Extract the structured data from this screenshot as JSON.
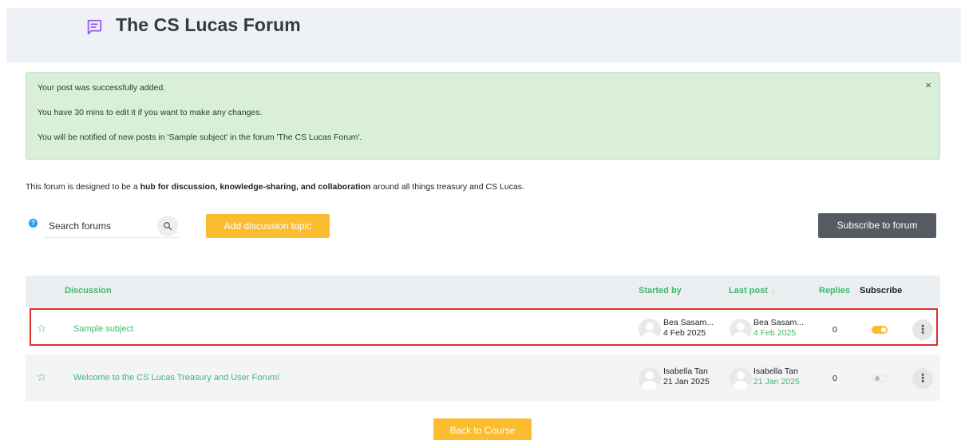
{
  "header": {
    "title": "The CS Lucas Forum",
    "icon": "message-square-icon",
    "icon_color": "#9b59f0"
  },
  "alert": {
    "lines": [
      "Your post was successfully added.",
      "You have 30 mins to edit it if you want to make any changes.",
      "You will be notified of new posts in 'Sample subject' in the forum 'The CS Lucas Forum'."
    ],
    "close_label": "×"
  },
  "intro": {
    "before": "This forum is designed to be a ",
    "bold": "hub for discussion, knowledge-sharing, and collaboration",
    "after": " around all things treasury and CS Lucas."
  },
  "toolbar": {
    "help_label": "?",
    "search_placeholder": "Search forums",
    "add_label": "Add discussion topic",
    "subscribe_label": "Subscribe to forum"
  },
  "table": {
    "headers": {
      "discussion": "Discussion",
      "started_by": "Started by",
      "last_post": "Last post",
      "last_post_arrow": "↓",
      "replies": "Replies",
      "subscribe": "Subscribe"
    },
    "rows": [
      {
        "title": "Sample subject",
        "started_name": "Bea Sasam...",
        "started_date": "4 Feb 2025",
        "last_name": "Bea Sasam...",
        "last_date": "4 Feb 2025",
        "replies": "0",
        "subscribed": true,
        "highlighted": true
      },
      {
        "title": "Welcome to the CS Lucas Treasury and User Forum!",
        "started_name": "Isabella Tan",
        "started_date": "21 Jan 2025",
        "last_name": "Isabella Tan",
        "last_date": "21 Jan 2025",
        "replies": "0",
        "subscribed": false,
        "highlighted": false
      }
    ]
  },
  "footer": {
    "back_label": "Back to Course"
  },
  "colors": {
    "accent_green": "#3dba6a",
    "accent_yellow": "#fbbd2f",
    "highlight_red": "#e0302a"
  }
}
